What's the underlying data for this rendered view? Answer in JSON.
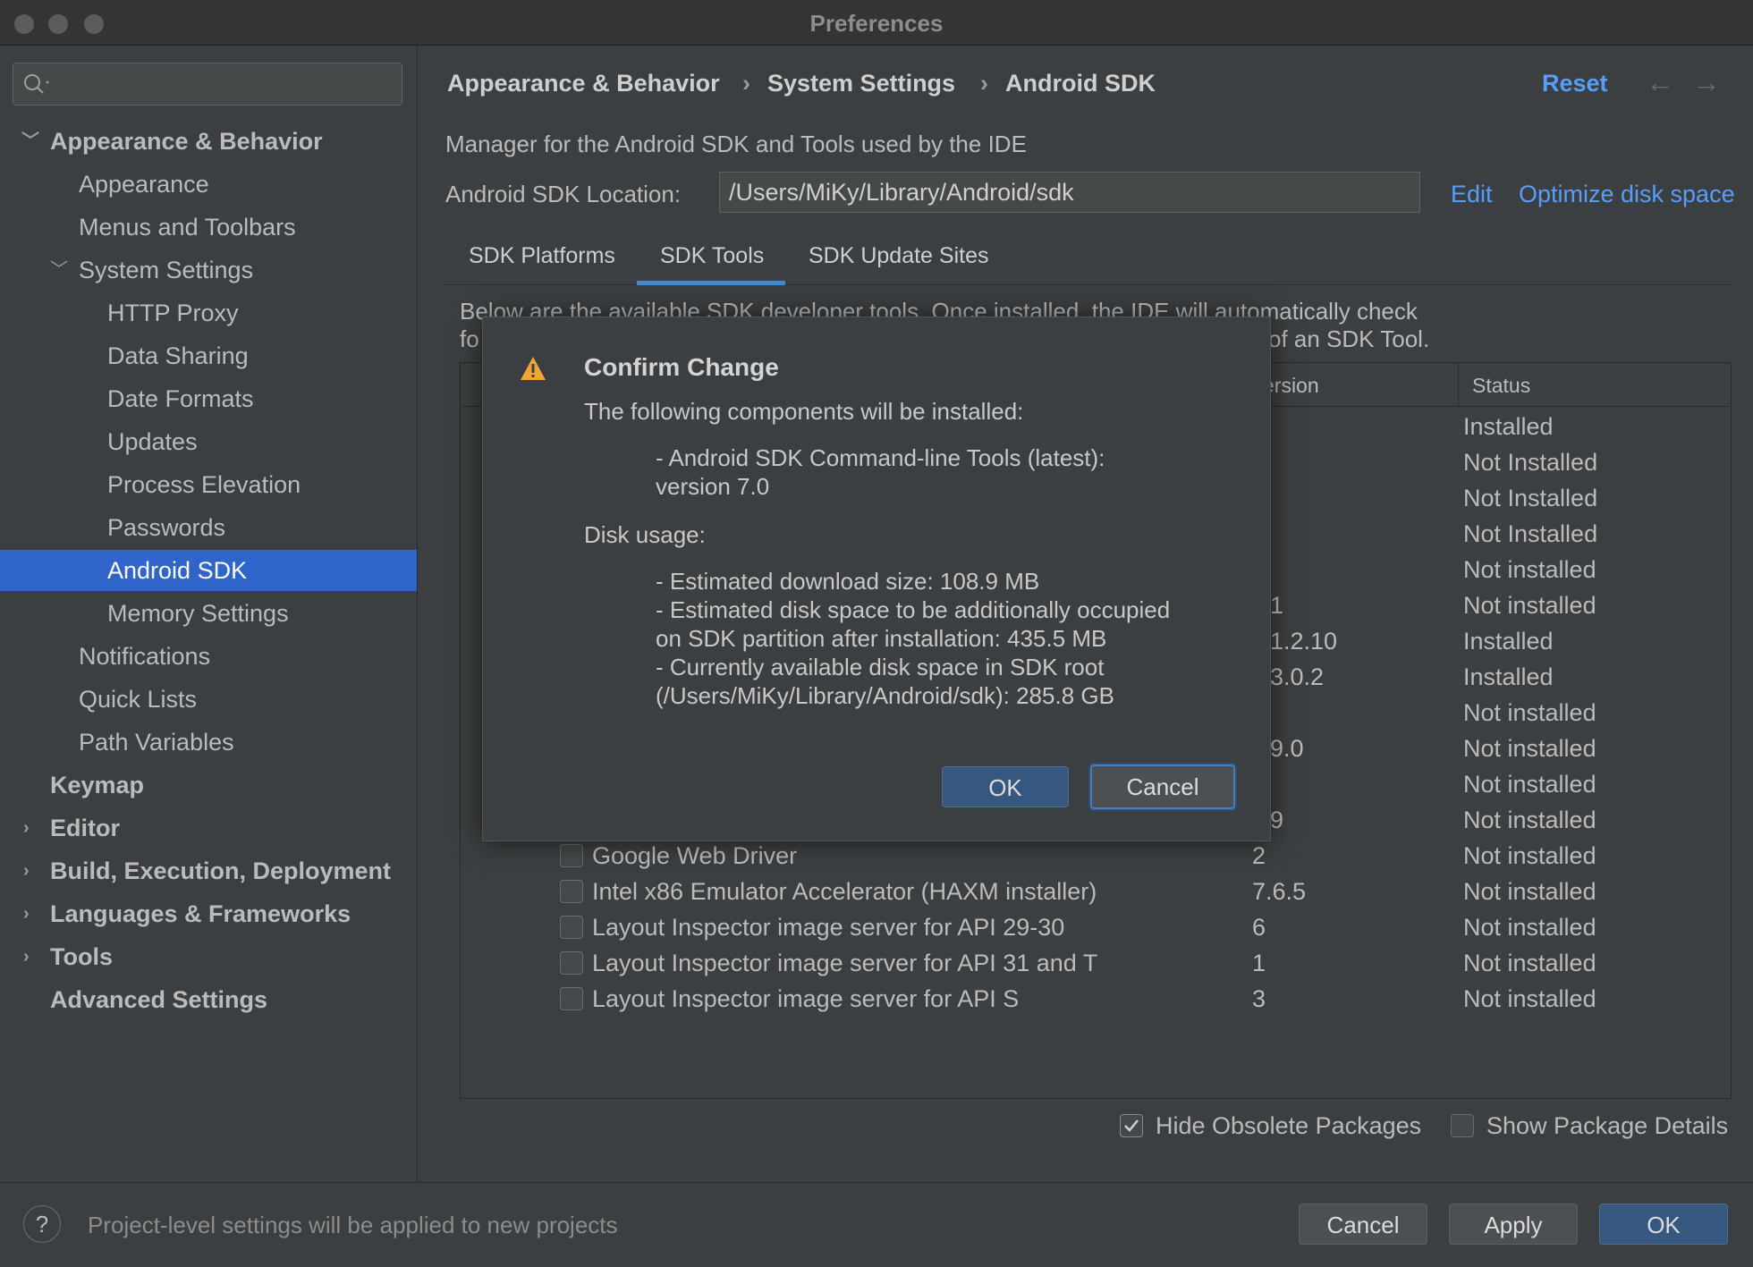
{
  "window": {
    "title": "Preferences"
  },
  "search": {
    "placeholder": ""
  },
  "sidebar": {
    "items": [
      {
        "label": "Appearance & Behavior"
      },
      {
        "label": "Appearance"
      },
      {
        "label": "Menus and Toolbars"
      },
      {
        "label": "System Settings"
      },
      {
        "label": "HTTP Proxy"
      },
      {
        "label": "Data Sharing"
      },
      {
        "label": "Date Formats"
      },
      {
        "label": "Updates"
      },
      {
        "label": "Process Elevation"
      },
      {
        "label": "Passwords"
      },
      {
        "label": "Android SDK"
      },
      {
        "label": "Memory Settings"
      },
      {
        "label": "Notifications"
      },
      {
        "label": "Quick Lists"
      },
      {
        "label": "Path Variables"
      },
      {
        "label": "Keymap"
      },
      {
        "label": "Editor"
      },
      {
        "label": "Build, Execution, Deployment"
      },
      {
        "label": "Languages & Frameworks"
      },
      {
        "label": "Tools"
      },
      {
        "label": "Advanced Settings"
      }
    ]
  },
  "header": {
    "breadcrumb": [
      "Appearance & Behavior",
      "System Settings",
      "Android SDK"
    ],
    "separator": "›",
    "reset_label": "Reset",
    "back_icon": "←",
    "forward_icon": "→"
  },
  "main": {
    "description": "Manager for the Android SDK and Tools used by the IDE",
    "location_label": "Android SDK Location:",
    "location_value": "/Users/MiKy/Library/Android/sdk",
    "edit_label": "Edit",
    "optimize_label": "Optimize disk space",
    "tabs": [
      {
        "label": "SDK Platforms"
      },
      {
        "label": "SDK Tools"
      },
      {
        "label": "SDK Update Sites"
      }
    ],
    "info_line1": "Below are the available SDK developer tools. Once installed, the IDE will automatically check",
    "info_line2_start": "fo",
    "info_line2_end": "of an SDK Tool.",
    "table": {
      "header_version": "Version",
      "header_version_partial": "ersion",
      "header_status": "Status",
      "status_column": [
        "Installed",
        "Not Installed",
        "Not Installed",
        "Not Installed",
        "Not installed",
        "Not installed",
        "Installed",
        "Installed",
        "Not installed",
        "Not installed",
        "Not installed",
        "Not installed"
      ],
      "version_partials": [
        "",
        "",
        "",
        "",
        "",
        "1",
        "1.2.10",
        "3.0.2",
        "",
        "9.0",
        "",
        "9"
      ],
      "visible_rows": [
        {
          "name": "Google Web Driver",
          "version": "2",
          "status": "Not installed"
        },
        {
          "name": "Intel x86 Emulator Accelerator (HAXM installer)",
          "version": "7.6.5",
          "status": "Not installed"
        },
        {
          "name": "Layout Inspector image server for API 29-30",
          "version": "6",
          "status": "Not installed"
        },
        {
          "name": "Layout Inspector image server for API 31 and T",
          "version": "1",
          "status": "Not installed"
        },
        {
          "name": "Layout Inspector image server for API S",
          "version": "3",
          "status": "Not installed"
        }
      ]
    },
    "hide_obsolete_label": "Hide Obsolete Packages",
    "show_details_label": "Show Package Details"
  },
  "dialog": {
    "title": "Confirm Change",
    "line1": "The following components will be installed:",
    "component_line1": "- Android SDK Command-line Tools (latest):",
    "component_line2": "version 7.0",
    "disk_usage_label": "Disk usage:",
    "disk_line1": "- Estimated download size: 108.9 MB",
    "disk_line2": "- Estimated disk space to be additionally occupied",
    "disk_line3": "on SDK partition after installation: 435.5 MB",
    "disk_line4": "- Currently available disk space in SDK root",
    "disk_line5": "(/Users/MiKy/Library/Android/sdk): 285.8 GB",
    "ok_label": "OK",
    "cancel_label": "Cancel",
    "warning_icon": "warning-icon"
  },
  "footer": {
    "help_label": "?",
    "message": "Project-level settings will be applied to new projects",
    "cancel_label": "Cancel",
    "apply_label": "Apply",
    "ok_label": "OK"
  },
  "colors": {
    "accent": "#2f65ca",
    "link": "#589df6",
    "warning": "#f0a732"
  }
}
